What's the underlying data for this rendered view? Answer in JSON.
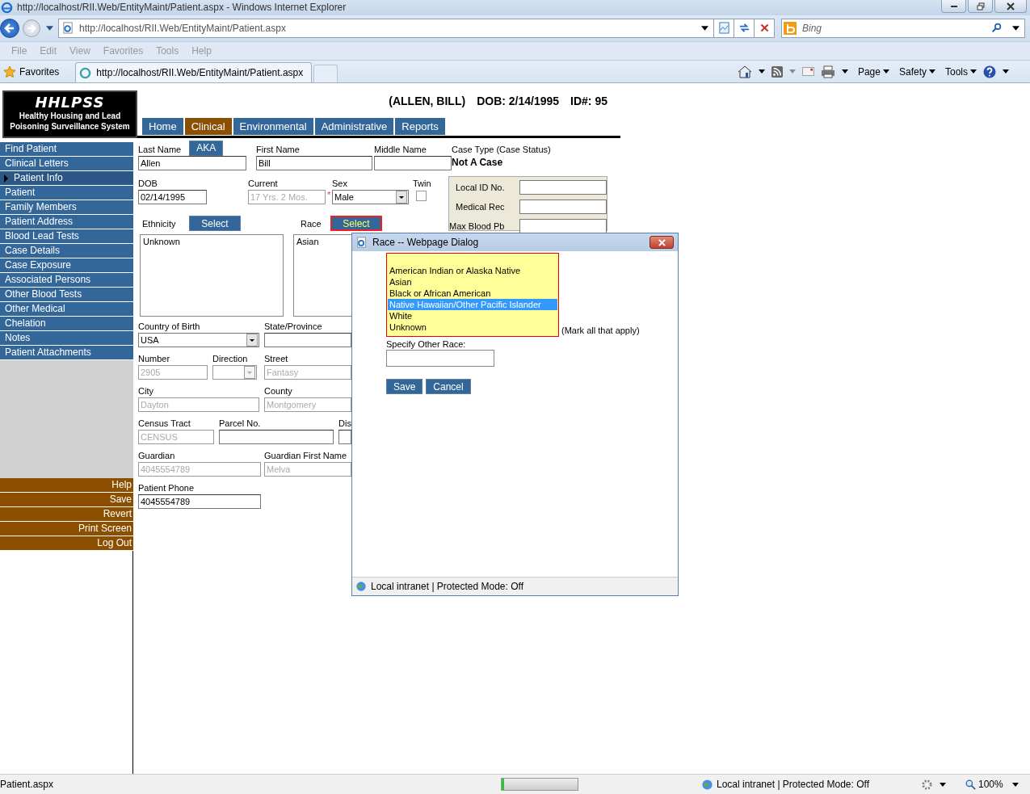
{
  "window": {
    "title": "http://localhost/RII.Web/EntityMaint/Patient.aspx - Windows Internet Explorer"
  },
  "address_bar": {
    "url": "http://localhost/RII.Web/EntityMaint/Patient.aspx"
  },
  "search": {
    "placeholder": "Bing"
  },
  "menu": [
    "File",
    "Edit",
    "View",
    "Favorites",
    "Tools",
    "Help"
  ],
  "favorites": {
    "label": "Favorites"
  },
  "tab": {
    "title": "http://localhost/RII.Web/EntityMaint/Patient.aspx"
  },
  "command_bar": [
    "Page",
    "Safety",
    "Tools"
  ],
  "app": {
    "logo_title": "HHLPSS",
    "logo_subtitle": "Healthy Housing and Lead Poisoning Surveillance System",
    "patient": [
      "(ALLEN, BILL)",
      "DOB: 2/14/1995",
      "ID#: 95"
    ]
  },
  "tabs": [
    {
      "label": "Home",
      "selected": false
    },
    {
      "label": "Clinical",
      "selected": true
    },
    {
      "label": "Environmental",
      "selected": false
    },
    {
      "label": "Administrative",
      "selected": false
    },
    {
      "label": "Reports",
      "selected": false
    }
  ],
  "nav": [
    {
      "label": "Find Patient",
      "selected": false
    },
    {
      "label": "Clinical Letters",
      "selected": false
    },
    {
      "label": "Patient Info",
      "selected": true
    },
    {
      "label": "Patient",
      "selected": false
    },
    {
      "label": "Family Members",
      "selected": false
    },
    {
      "label": "Patient Address",
      "selected": false
    },
    {
      "label": "Blood Lead Tests",
      "selected": false
    },
    {
      "label": "Case Details",
      "selected": false
    },
    {
      "label": "Case Exposure",
      "selected": false
    },
    {
      "label": "Associated Persons",
      "selected": false
    },
    {
      "label": "Other Blood Tests",
      "selected": false
    },
    {
      "label": "Other Medical",
      "selected": false
    },
    {
      "label": "Chelation",
      "selected": false
    },
    {
      "label": "Notes",
      "selected": false
    },
    {
      "label": "Patient Attachments",
      "selected": false
    }
  ],
  "actions": [
    "Help",
    "Save",
    "Revert",
    "Print Screen",
    "Log Out"
  ],
  "form": {
    "last_name": {
      "label": "Last Name",
      "kind": "text",
      "value": "Allen",
      "disabled": false,
      "button": "AKA"
    },
    "first_name": {
      "label": "First Name",
      "kind": "text",
      "value": "Bill",
      "disabled": false
    },
    "middle_name": {
      "label": "Middle Name",
      "kind": "text",
      "disabled": false
    },
    "case_type": {
      "label": "Case Type (Case Status)",
      "kind": "static",
      "value": "Not A Case"
    },
    "dob": {
      "label": "DOB",
      "kind": "text",
      "value": "02/14/1995",
      "disabled": false
    },
    "current": {
      "label": "Current",
      "kind": "text",
      "value": "17 Yrs. 2 Mos.",
      "disabled": true,
      "required_mark": "*"
    },
    "sex": {
      "label": "Sex",
      "kind": "select",
      "value": "Male",
      "disabled": false
    },
    "twin": {
      "label": "Twin",
      "kind": "checkbox",
      "checked": false
    },
    "id_panel": {
      "kind": "panel",
      "fields": [
        {
          "label": "Local ID No."
        },
        {
          "label": "Medical Rec"
        },
        {
          "label": "Max Blood Pb"
        }
      ]
    },
    "ethnicity": {
      "label": "Ethnicity",
      "kind": "picker",
      "button": "Select",
      "focused": false
    },
    "race": {
      "label": "Race",
      "kind": "picker",
      "button": "Select",
      "focused": true
    },
    "ethnicity_list": {
      "kind": "list",
      "values": [
        "Unknown"
      ]
    },
    "race_list": {
      "kind": "list",
      "values": [
        "Asian"
      ]
    },
    "country_of_birth": {
      "label": "Country of Birth",
      "kind": "select",
      "value": "USA",
      "disabled": false
    },
    "state_province": {
      "label": "State/Province",
      "kind": "text",
      "disabled": false
    },
    "number": {
      "label": "Number",
      "kind": "text",
      "value": "2905",
      "disabled": true
    },
    "direction": {
      "label": "Direction",
      "kind": "select",
      "disabled": true
    },
    "street": {
      "label": "Street",
      "kind": "text",
      "value": "Fantasy",
      "disabled": true
    },
    "city": {
      "label": "City",
      "kind": "text",
      "value": "Dayton",
      "disabled": true
    },
    "county": {
      "label": "County",
      "kind": "text",
      "value": "Montgomery",
      "disabled": true
    },
    "census_tract": {
      "label": "Census Tract",
      "kind": "text",
      "value": "CENSUS",
      "disabled": true
    },
    "parcel_no": {
      "label": "Parcel No.",
      "kind": "text",
      "disabled": false
    },
    "district": {
      "label": "Dis",
      "kind": "text",
      "disabled": false
    },
    "guardian": {
      "label": "Guardian",
      "kind": "text",
      "value": "4045554789",
      "disabled": true
    },
    "guardian_first_name": {
      "label": "Guardian First Name",
      "kind": "text",
      "value": "Melva",
      "disabled": true
    },
    "patient_phone": {
      "label": "Patient Phone",
      "kind": "text",
      "value": "4045554789",
      "disabled": false
    }
  },
  "dialog": {
    "title": "Race -- Webpage Dialog",
    "options": [
      {
        "label": "American Indian or Alaska Native",
        "selected": false
      },
      {
        "label": "Asian",
        "selected": false
      },
      {
        "label": "Black or African American",
        "selected": false
      },
      {
        "label": "Native Hawaiian/Other Pacific Islander",
        "selected": true
      },
      {
        "label": "White",
        "selected": false
      },
      {
        "label": "Unknown",
        "selected": false
      }
    ],
    "note": "(Mark all that apply)",
    "other": {
      "label": "Specify Other Race:"
    },
    "buttons": [
      "Save",
      "Cancel"
    ],
    "status": "Local intranet | Protected Mode: Off"
  },
  "status_bar": {
    "text": "Patient.aspx",
    "progress": {
      "level": 0.03
    },
    "zone": "Local intranet | Protected Mode: Off",
    "zoom": "100%"
  }
}
